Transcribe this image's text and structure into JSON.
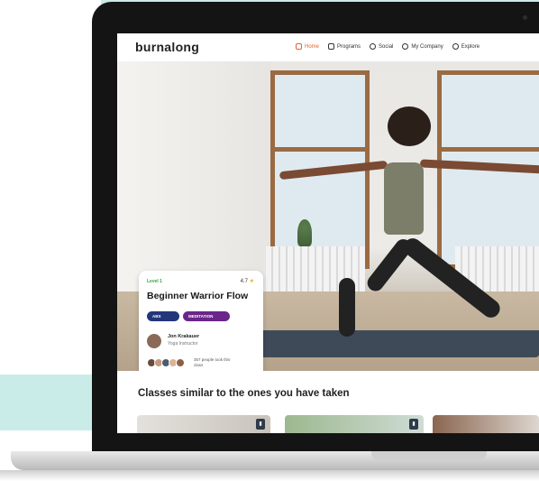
{
  "app": {
    "logo": "burnalong"
  },
  "nav": {
    "items": [
      {
        "label": "Home",
        "icon": "home-icon",
        "active": true
      },
      {
        "label": "Programs",
        "icon": "document-icon",
        "active": false
      },
      {
        "label": "Social",
        "icon": "people-icon",
        "active": false
      },
      {
        "label": "My Company",
        "icon": "globe-icon",
        "active": false
      },
      {
        "label": "Explore",
        "icon": "search-icon",
        "active": false
      }
    ],
    "active_color": "#e8622b"
  },
  "card": {
    "level": "Level 1",
    "rating": "4.7",
    "title": "Beginner Warrior Flow",
    "tags": [
      {
        "label": "ABS",
        "color": "#22367a"
      },
      {
        "label": "MEDITATION",
        "color": "#6a2689"
      }
    ],
    "instructor_name": "Jon Krakauer",
    "instructor_role": "Yoga Instructor",
    "participants_text": "357 people took this class"
  },
  "section": {
    "title": "Classes similar to the ones you have taken"
  },
  "colors": {
    "accent": "#e8622b",
    "teal_bg": "#c9ece9",
    "level_green": "#35a64a"
  }
}
